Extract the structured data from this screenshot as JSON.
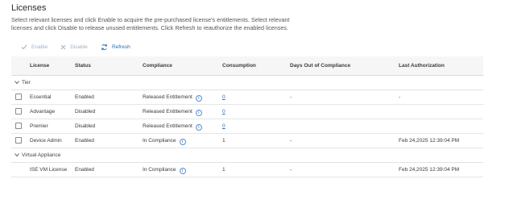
{
  "page": {
    "title": "Licenses",
    "description": "Select relevant licenses and click Enable to acquire the pre-purchased license's entitlements. Select relevant licenses and click Disable to release unused entitlements. Click Refresh to reauthorize the enabled licenses."
  },
  "toolbar": {
    "enable_label": "Enable",
    "disable_label": "Disable",
    "refresh_label": "Refresh"
  },
  "table": {
    "columns": {
      "license": "License",
      "status": "Status",
      "compliance": "Compliance",
      "consumption": "Consumption",
      "days": "Days Out of Compliance",
      "auth": "Last Authorization"
    },
    "groups": [
      {
        "label": "Tier",
        "rows": [
          {
            "license": "Essential",
            "status": "Enabled",
            "compliance": "Released Entitlement",
            "consumption": "0",
            "days": "-",
            "auth": "-"
          },
          {
            "license": "Advantage",
            "status": "Disabled",
            "compliance": "Released Entitlement",
            "consumption": "0",
            "days": "",
            "auth": ""
          },
          {
            "license": "Premier",
            "status": "Disabled",
            "compliance": "Released Entitlement",
            "consumption": "0",
            "days": "",
            "auth": ""
          },
          {
            "license": "Device Admin",
            "status": "Enabled",
            "compliance": "In Compliance",
            "consumption": "1",
            "days": "-",
            "auth": "Feb 24,2025 12:39:04 PM"
          }
        ]
      },
      {
        "label": "Virtual Appliance",
        "rows": [
          {
            "license": "ISE VM License",
            "status": "Enabled",
            "compliance": "In Compliance",
            "consumption": "1",
            "days": "-",
            "auth": "Feb 24,2025 12:39:04 PM"
          }
        ]
      }
    ]
  },
  "colors": {
    "link": "#2f6db3",
    "disabled_action": "#9db3c9",
    "header_bg": "#f6f6f6"
  },
  "icons": {
    "enable": "check-icon",
    "disable": "x-icon",
    "refresh": "refresh-icon",
    "info": "info-icon",
    "group_toggle": "chevron-down-icon"
  }
}
